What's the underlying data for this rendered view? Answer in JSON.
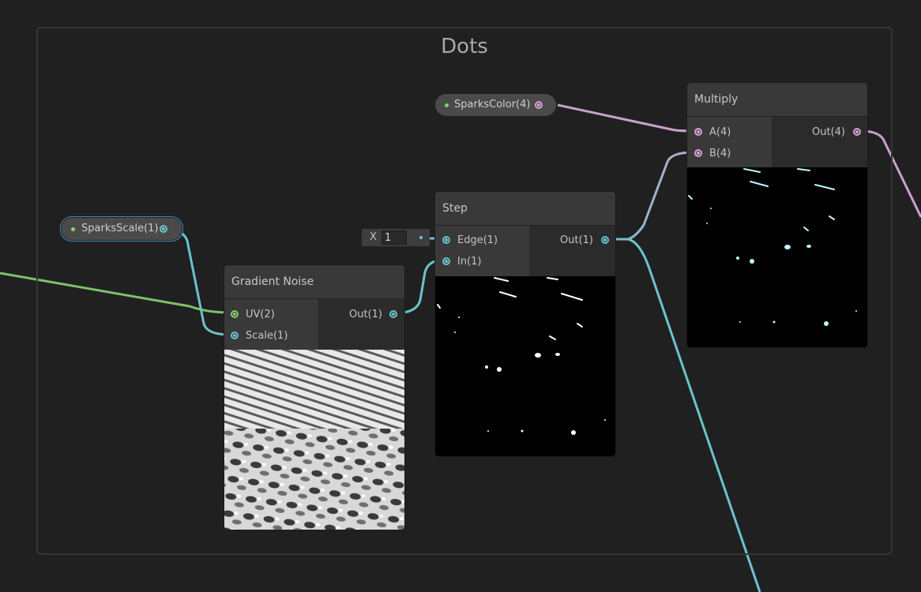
{
  "group": {
    "title": "Dots"
  },
  "properties": {
    "sparks_scale": "SparksScale(1)",
    "sparks_color": "SparksColor(4)"
  },
  "nodes": {
    "gradient_noise": {
      "title": "Gradient Noise",
      "inputs": [
        "UV(2)",
        "Scale(1)"
      ],
      "output": "Out(1)"
    },
    "step": {
      "title": "Step",
      "inputs": [
        "Edge(1)",
        "In(1)"
      ],
      "output": "Out(1)",
      "edge_field": {
        "axis": "X",
        "value": "1"
      }
    },
    "multiply": {
      "title": "Multiply",
      "inputs": [
        "A(4)",
        "B(4)"
      ],
      "output": "Out(4)"
    }
  },
  "colors": {
    "float_wire": "#6bc3cc",
    "vector4_wire": "#c9a0cc",
    "uv_wire": "#7cc26a",
    "selection": "#3b8fc5"
  }
}
